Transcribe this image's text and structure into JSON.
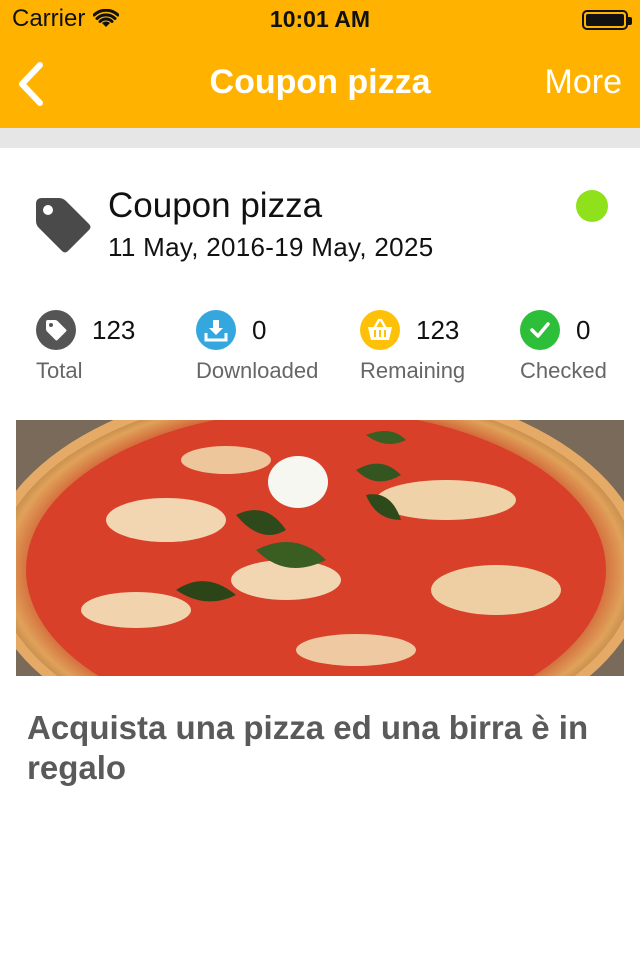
{
  "status_bar": {
    "carrier": "Carrier",
    "time": "10:01 AM"
  },
  "nav": {
    "title": "Coupon pizza",
    "more_label": "More",
    "back_icon": "chevron-left-icon"
  },
  "coupon": {
    "title": "Coupon pizza",
    "dates": "11 May, 2016-19 May, 2025",
    "status_color": "#8FE21B"
  },
  "stats": [
    {
      "value": "123",
      "label": "Total",
      "icon": "tag-icon",
      "color": "#555555"
    },
    {
      "value": "0",
      "label": "Downloaded",
      "icon": "download-icon",
      "color": "#34A8DE"
    },
    {
      "value": "123",
      "label": "Remaining",
      "icon": "basket-icon",
      "color": "#FFC107"
    },
    {
      "value": "0",
      "label": "Checked",
      "icon": "checkmark-icon",
      "color": "#2DBF3A"
    }
  ],
  "image": {
    "subject": "pizza-photo"
  },
  "description": "Acquista una pizza ed una birra è in regalo",
  "colors": {
    "accent": "#FFB300",
    "separator": "#E6E6E6",
    "description_text": "#5A5A5A"
  }
}
